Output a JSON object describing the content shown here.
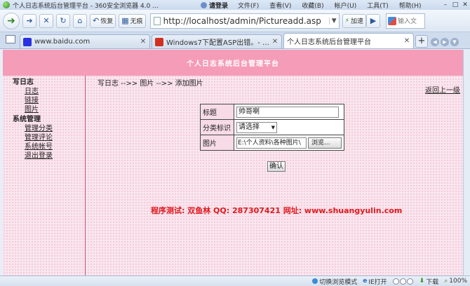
{
  "browser": {
    "window_title": "个人日志系统后台管理平台 - 360安全浏览器 4.0 ...",
    "login_label": "请登录",
    "menu": [
      "文件(F)",
      "查看(V)",
      "收藏(B)",
      "帐户(U)",
      "工具(T)",
      "帮助(H)"
    ],
    "toolbar": {
      "restore_label": "恢复",
      "ads_label": "无痕",
      "address": "http://localhost/admin/Pictureadd.asp",
      "accelerate_label": "加速",
      "search_placeholder": "输入文"
    },
    "tabs": [
      {
        "label": "www.baidu.com",
        "icon": "baidu-icon",
        "active": false
      },
      {
        "label": "Windows7下配置ASP出错。- W...",
        "icon": "windows-icon",
        "active": false
      },
      {
        "label": "个人日志系统后台管理平台",
        "icon": "page-icon",
        "active": true
      }
    ],
    "status": {
      "mode_label": "切换浏览模式",
      "ie_label": "IE打开",
      "download_label": "下载",
      "zoom": "100%"
    }
  },
  "page": {
    "banner_title": "个人日志系统后台管理平台",
    "sidebar": {
      "section1": "写日志",
      "section1_links": [
        "日志",
        "链接",
        "图片"
      ],
      "section2": "系统管理",
      "section2_links": [
        "管理分类",
        "管理评论",
        "系统帐号",
        "退出登录"
      ]
    },
    "breadcrumb": "写日志 -->> 图片 -->> 添加图片",
    "back_link": "返回上一级",
    "form": {
      "title_label": "标题",
      "title_value": "帅哥喇",
      "category_label": "分类标识",
      "category_value": "请选择",
      "image_label": "图片",
      "image_path": "E:\\个人资料\\各种图片\\",
      "browse_label": "浏览...",
      "submit_label": "确认"
    },
    "credit": "程序测试: 双鱼林  QQ: 287307421  网址: www.shuangyulin.com"
  }
}
